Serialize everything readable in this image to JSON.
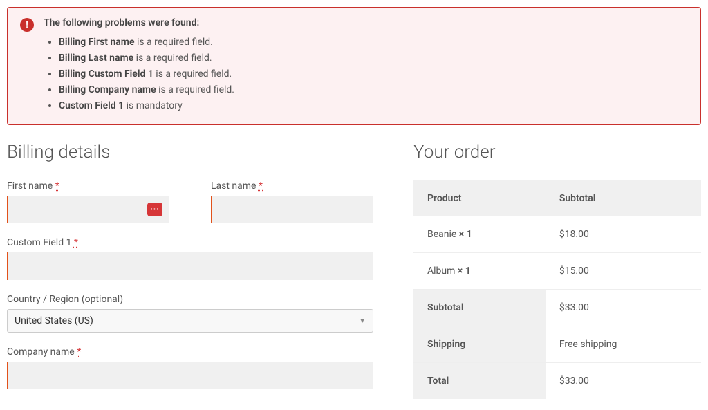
{
  "error": {
    "heading": "The following problems were found:",
    "items": [
      {
        "bold": "Billing First name",
        "rest": " is a required field."
      },
      {
        "bold": "Billing Last name",
        "rest": " is a required field."
      },
      {
        "bold": "Billing Custom Field 1",
        "rest": " is a required field."
      },
      {
        "bold": "Billing Company name",
        "rest": " is a required field."
      },
      {
        "bold": "Custom Field 1",
        "rest": " is mandatory"
      }
    ]
  },
  "billing": {
    "heading": "Billing details",
    "first_name": {
      "label": "First name ",
      "star": "*",
      "value": ""
    },
    "last_name": {
      "label": "Last name ",
      "star": "*",
      "value": ""
    },
    "custom_field_1": {
      "label": "Custom Field 1 ",
      "star": "*",
      "value": ""
    },
    "country": {
      "label": "Country / Region (optional)",
      "value": "United States (US)"
    },
    "company": {
      "label": "Company name ",
      "star": "*",
      "value": ""
    }
  },
  "order": {
    "heading": "Your order",
    "columns": {
      "product": "Product",
      "subtotal": "Subtotal"
    },
    "items": [
      {
        "name": "Beanie  ",
        "qty": "× 1",
        "price": "$18.00"
      },
      {
        "name": "Album  ",
        "qty": "× 1",
        "price": "$15.00"
      }
    ],
    "summary": {
      "subtotal_label": "Subtotal",
      "subtotal_value": "$33.00",
      "shipping_label": "Shipping",
      "shipping_value": "Free shipping",
      "total_label": "Total",
      "total_value": "$33.00"
    }
  }
}
